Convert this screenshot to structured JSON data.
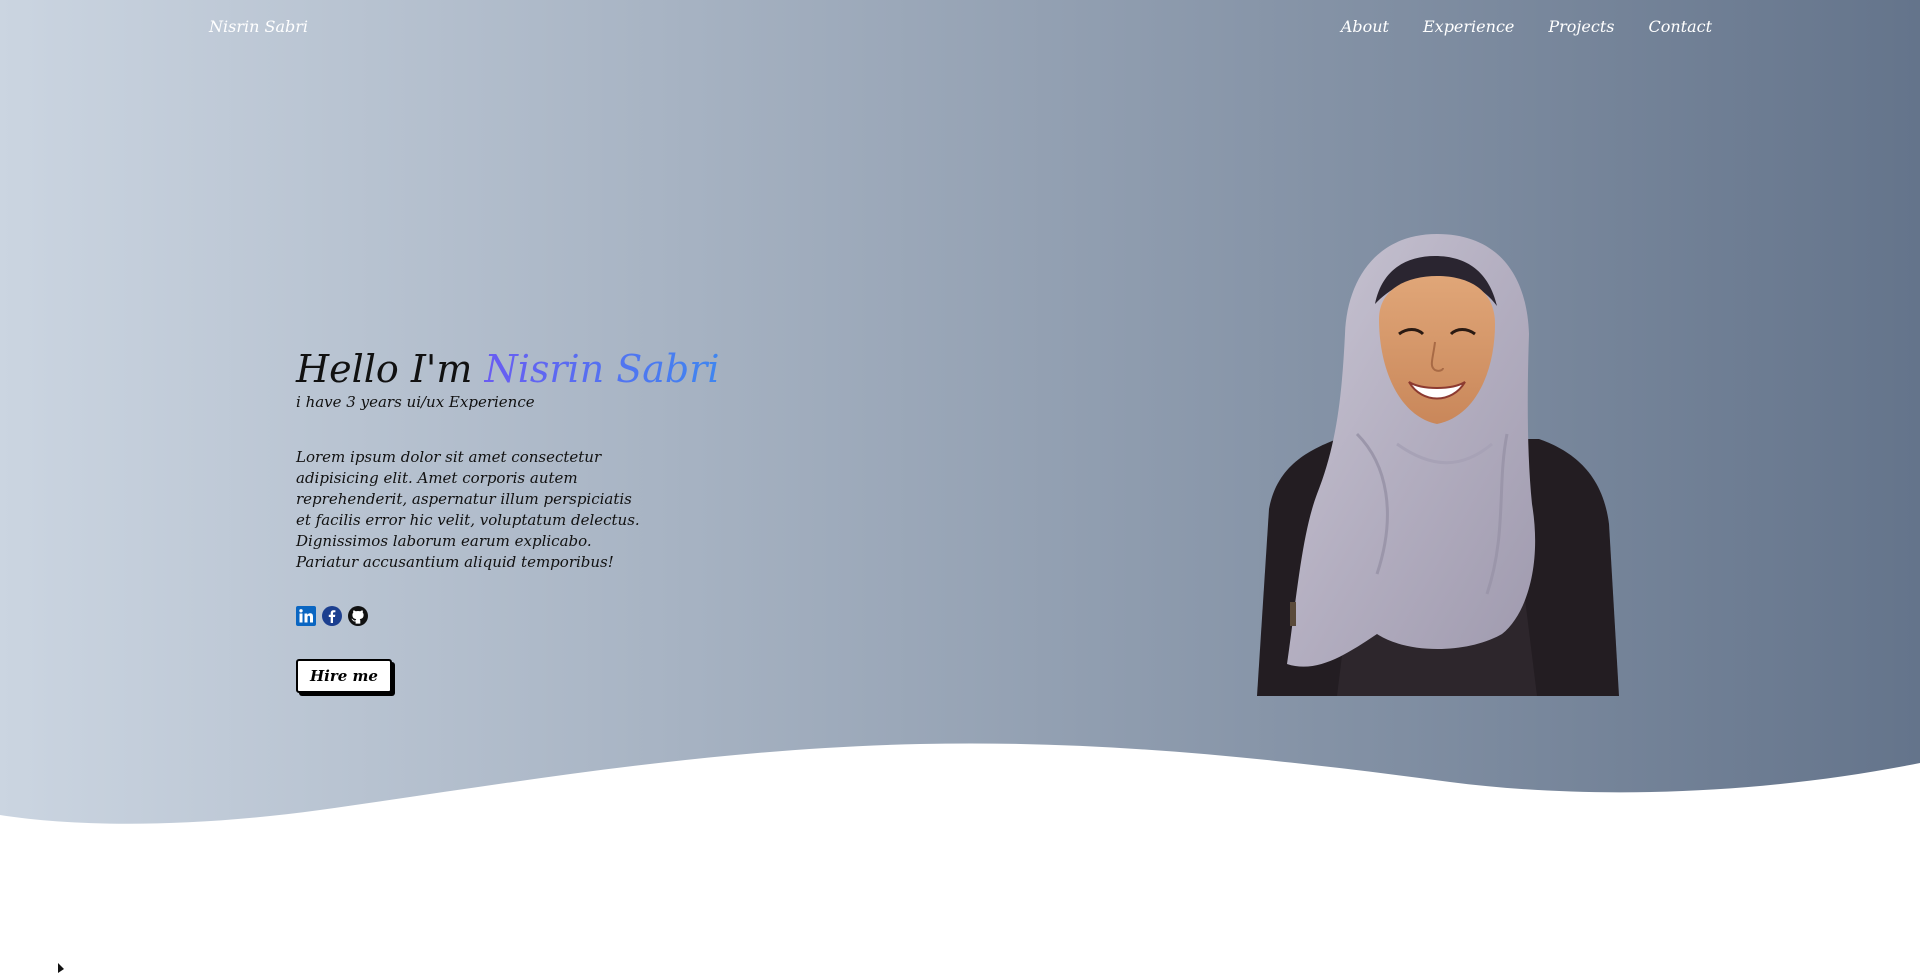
{
  "nav": {
    "brand": "Nisrin Sabri",
    "links": [
      "About",
      "Experience",
      "Projects",
      "Contact"
    ]
  },
  "intro": {
    "greeting": "Hello I'm ",
    "name": "Nisrin Sabri",
    "subtitle": "i have 3 years ui/ux Experience",
    "description": "Lorem ipsum dolor sit amet consectetur adipisicing elit. Amet corporis autem reprehenderit, aspernatur illum perspiciatis et facilis error hic velit, voluptatum delectus. Dignissimos laborum earum explicabo. Pariatur accusantium aliquid temporibus!",
    "socials": [
      "linkedin-icon",
      "facebook-icon",
      "github-icon"
    ],
    "hire_label": "Hire me"
  },
  "colors": {
    "gradient_start": "#cbd5e1",
    "gradient_end": "#64748b",
    "name_gradient_start": "#6a5cf2",
    "name_gradient_end": "#3f86f0",
    "linkedin": "#0a66c2",
    "facebook": "#1c3f8f"
  }
}
